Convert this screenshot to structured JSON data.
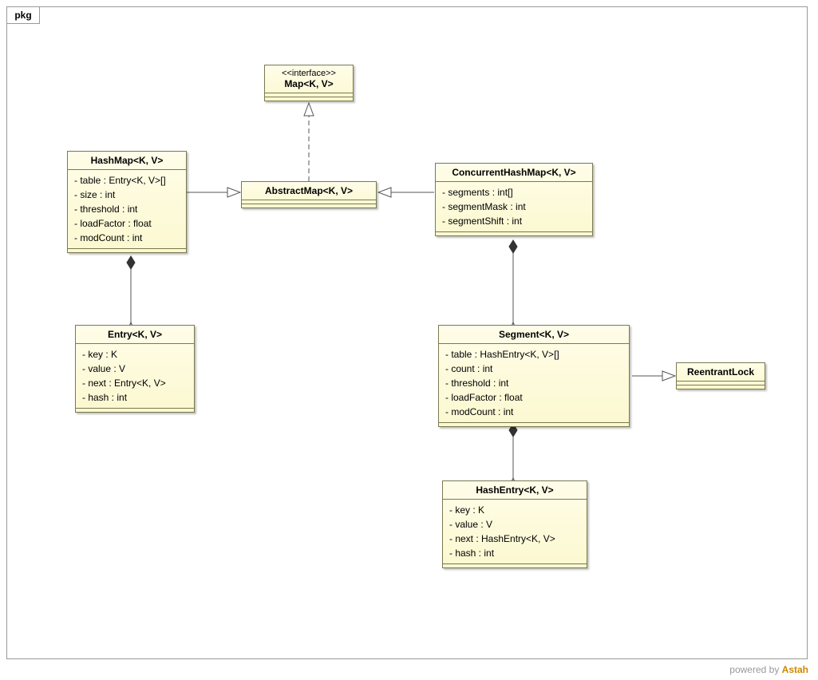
{
  "package_label": "pkg",
  "footer_prefix": "powered by ",
  "footer_brand": "Astah",
  "classes": {
    "map": {
      "stereotype": "<<interface>>",
      "name": "Map<K, V>"
    },
    "abstractmap": {
      "name": "AbstractMap<K, V>"
    },
    "hashmap": {
      "name": "HashMap<K, V>",
      "attrs": [
        "- table : Entry<K, V>[]",
        "- size : int",
        "- threshold : int",
        "- loadFactor : float",
        "- modCount : int"
      ]
    },
    "concurrenthashmap": {
      "name": "ConcurrentHashMap<K, V>",
      "attrs": [
        "- segments : int[]",
        "- segmentMask : int",
        "- segmentShift : int"
      ]
    },
    "entry": {
      "name": "Entry<K, V>",
      "attrs": [
        "- key : K",
        "- value : V",
        "- next : Entry<K, V>",
        "- hash : int"
      ]
    },
    "segment": {
      "name": "Segment<K, V>",
      "attrs": [
        "- table : HashEntry<K, V>[]",
        "- count : int",
        "- threshold : int",
        "- loadFactor : float",
        "- modCount : int"
      ]
    },
    "reentrantlock": {
      "name": "ReentrantLock"
    },
    "hashentry": {
      "name": "HashEntry<K, V>",
      "attrs": [
        "- key : K",
        "- value : V",
        "- next : HashEntry<K, V>",
        "- hash : int"
      ]
    }
  }
}
